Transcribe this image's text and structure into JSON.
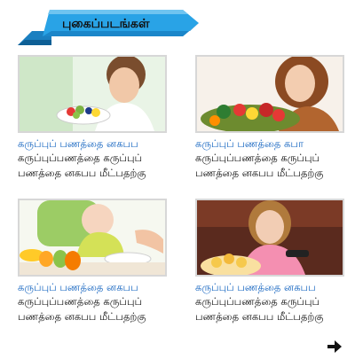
{
  "section": {
    "title": "புகைப்படங்கள்",
    "colors": {
      "banner": "#29a3e6",
      "banner_dark": "#1a7fc0",
      "link": "#1565c0"
    }
  },
  "cards": [
    {
      "title": "கருப்புப் பணத்தை னகபப",
      "desc_line1": "கருப்புப்பணத்தை கருப்புப்",
      "desc_line2": "பணத்தை னகபப மீட்பதற்கு",
      "image": "woman-eating-salad"
    },
    {
      "title": "கருப்புப் பணத்தை கபா",
      "desc_line1": "கருப்புப்பணத்தை கருப்புப்",
      "desc_line2": "பணத்தை னகபப மீட்பதற்கு",
      "image": "woman-with-vegetables"
    },
    {
      "title": "கருப்புப் பணத்தை னகபப",
      "desc_line1": "கருப்புப்பணத்தை கருப்புப்",
      "desc_line2": "பணத்தை னகபப மீட்பதற்கு",
      "image": "baby-with-fruits"
    },
    {
      "title": "கருப்புப் பணத்தை னகபப",
      "desc_line1": "கருப்புப்பணத்தை கருப்புப்",
      "desc_line2": "பணத்தை னகபப மீட்பதற்கு",
      "image": "girl-with-chips-remote"
    }
  ],
  "pager": {
    "next_icon": "arrow-right-icon"
  }
}
